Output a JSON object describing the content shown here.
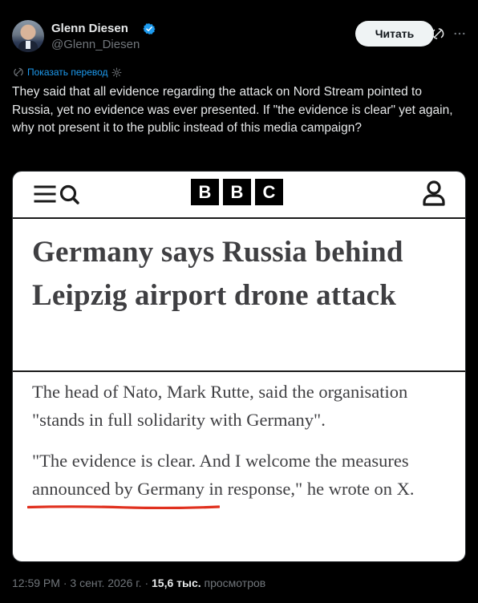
{
  "author": {
    "name": "Glenn Diesen",
    "handle": "@Glenn_Diesen",
    "verified_color": "#1d9bf0"
  },
  "header": {
    "read_label": "Читать"
  },
  "translate": {
    "label": "Показать перевод"
  },
  "tweet": {
    "text": "They said that all evidence regarding the attack on Nord Stream pointed to Russia, yet no evidence was ever presented. If \"the evidence is clear\" yet again, why not present it to the public instead of this media campaign?"
  },
  "article": {
    "logo": [
      "B",
      "B",
      "C"
    ],
    "headline": "Germany says Russia behind Leipzig airport drone attack",
    "paragraph1": "The head of Nato, Mark Rutte, said the organisation \"stands in full solidarity with Germany\".",
    "paragraph2": "\"The evidence is clear. And I welcome the measures announced by Germany in response,\" he wrote on X.",
    "highlight_color": "#e0301e"
  },
  "meta": {
    "time": "12:59 PM",
    "date": "3 сент. 2026 г.",
    "separator": "·",
    "views": "15,6 тыс.",
    "views_label": "просмотров"
  },
  "icons": {
    "verified": "verified-badge-icon",
    "grok": "grok-icon",
    "more": "more-icon",
    "translate": "translate-icon",
    "menu": "menu-icon",
    "search": "search-icon",
    "account": "account-icon"
  }
}
